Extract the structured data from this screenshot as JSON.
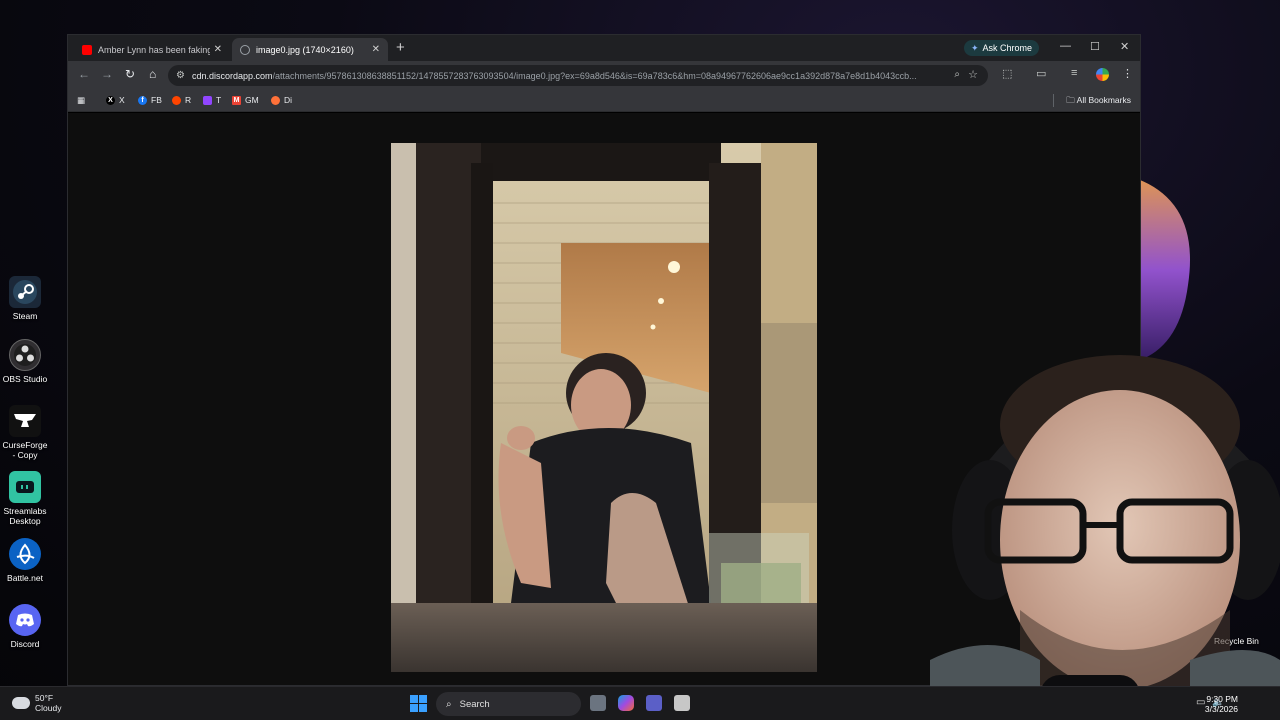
{
  "desktop": {
    "icons": [
      {
        "label": "Steam"
      },
      {
        "label": "OBS Studio"
      },
      {
        "label": "CurseForge - Copy"
      },
      {
        "label": "Streamlabs Desktop"
      },
      {
        "label": "Battle.net"
      },
      {
        "label": "Discord"
      }
    ],
    "recycle_bin": "Recycle Bin"
  },
  "browser": {
    "tabs": [
      {
        "title": "Amber Lynn has been faking he",
        "icon": "youtube-icon",
        "color": "#ff0000"
      },
      {
        "title": "image0.jpg (1740×2160)",
        "icon": "globe-icon",
        "color": "#9aa0a6"
      }
    ],
    "ask_chrome": "Ask Chrome",
    "url": {
      "host": "cdn.discordapp.com",
      "path": "/attachments/957861308638851152/1478557283763093504/image0.jpg?ex=69a8d546&is=69a783c6&hm=08a94967762606ae9cc1a392d878a7e8d1b4043ccb..."
    },
    "bookmarks": [
      {
        "label": "X",
        "icon": "x-icon",
        "color": "#000000"
      },
      {
        "label": "FB",
        "icon": "facebook-icon",
        "color": "#1877f2"
      },
      {
        "label": "R",
        "icon": "reddit-icon",
        "color": "#ff4500"
      },
      {
        "label": "T",
        "icon": "twitch-icon",
        "color": "#9146ff"
      },
      {
        "label": "GM",
        "icon": "gmail-icon",
        "color": "#ea4335"
      },
      {
        "label": "Di",
        "icon": "firefox-icon",
        "color": "#ff7139"
      }
    ],
    "all_bookmarks": "All Bookmarks"
  },
  "taskbar": {
    "weather_temp": "50°F",
    "weather_cond": "Cloudy",
    "search_label": "Search",
    "time": "9:30 PM",
    "date": "3/3/2026"
  }
}
